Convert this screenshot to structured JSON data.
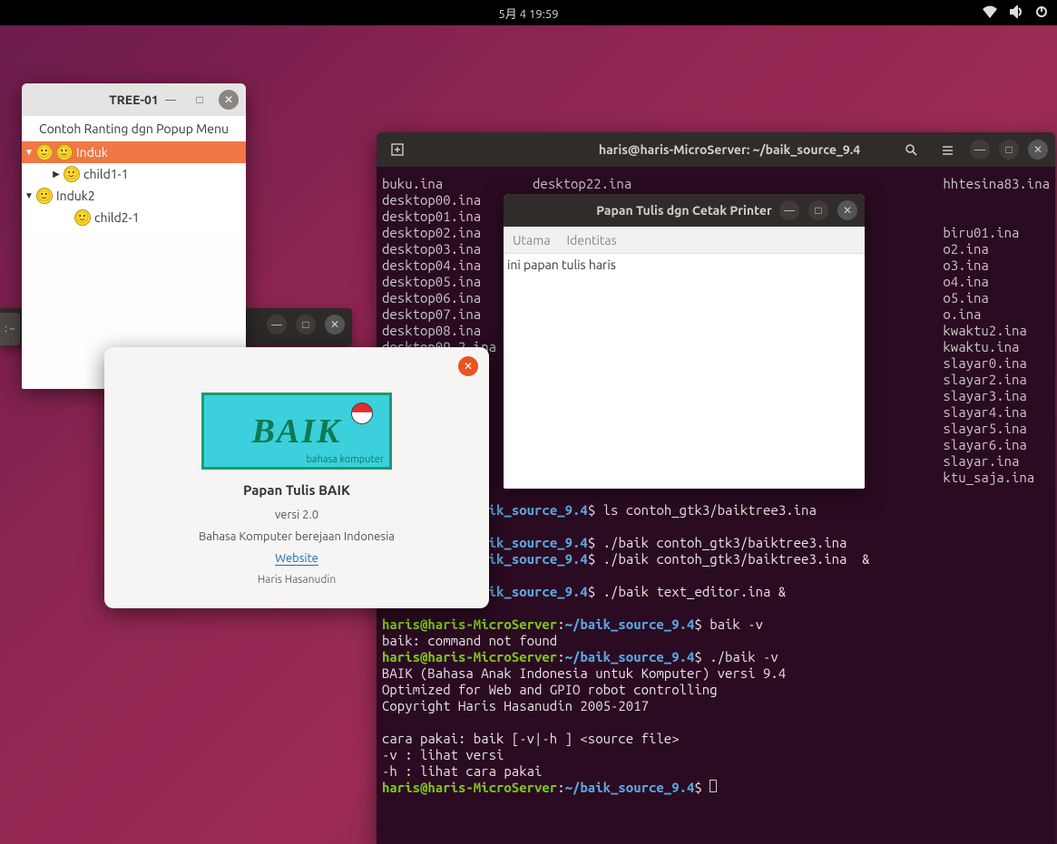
{
  "topbar": {
    "datetime": "5月 4  19:59"
  },
  "tree_window": {
    "title": "TREE-01",
    "subheader": "Contoh Ranting dgn Popup Menu",
    "items": {
      "root1": "Induk",
      "child11": "child1-1",
      "root2": "Induk2",
      "child21": "child2-1"
    }
  },
  "dock_mini": ": ~",
  "about": {
    "logo_main": "BAIK",
    "logo_sub": "bahasa komputer",
    "title": "Papan Tulis BAIK",
    "version": "versi 2.0",
    "desc": "Bahasa Komputer berejaan Indonesia",
    "link": "Website",
    "author": "Haris Hasanudin"
  },
  "terminal": {
    "title": "haris@haris-MicroServer: ~/baik_source_9.4",
    "files_col1": [
      "buku.ina",
      "desktop00.ina",
      "desktop01.ina",
      "desktop02.ina",
      "desktop03.ina",
      "desktop04.ina",
      "desktop05.ina",
      "desktop06.ina",
      "desktop07.ina",
      "desktop08.ina",
      "desktop09-2.ina"
    ],
    "files_col2": [
      "desktop22.ina"
    ],
    "files_col3": [
      "hhtesina83.ina",
      "",
      "",
      "biru01.ina",
      "o2.ina",
      "o3.ina",
      "o4.ina",
      "o5.ina",
      "o.ina",
      "kwaktu2.ina",
      "kwaktu.ina",
      "slayar0.ina",
      "slayar2.ina",
      "slayar3.ina",
      "slayar4.ina",
      "slayar5.ina",
      "slayar6.ina",
      "slayar.ina",
      "ktu_saja.ina"
    ],
    "prompt_user": "haris@haris-MicroServer",
    "prompt_user_short": "croServer",
    "prompt_path": "~/baik_source_9.4",
    "cmd_ls": "ls contoh_gtk3/baiktree3.ina",
    "resp_ls": "iktree3.ina",
    "cmd1": "./baik contoh_gtk3/baiktree3.ina",
    "cmd2": "./baik contoh_gtk3/baiktree3.ina  &",
    "cmd3": "./baik text_editor.ina &",
    "cmd4": "baik -v",
    "resp4": "baik: command not found",
    "cmd5": "./baik -v",
    "out_lines": [
      "BAIK (Bahasa Anak Indonesia untuk Komputer) versi 9.4",
      "Optimized for Web and GPIO robot controlling",
      "Copyright Haris Hasanudin 2005-2017",
      "",
      "cara pakai: baik [-v|-h ] <source file>",
      "-v : lihat versi",
      "-h : lihat cara pakai"
    ]
  },
  "editor": {
    "title": "Papan Tulis dgn Cetak Printer",
    "menu1": "Utama",
    "menu2": "Identitas",
    "content": "ini papan tulis haris"
  }
}
